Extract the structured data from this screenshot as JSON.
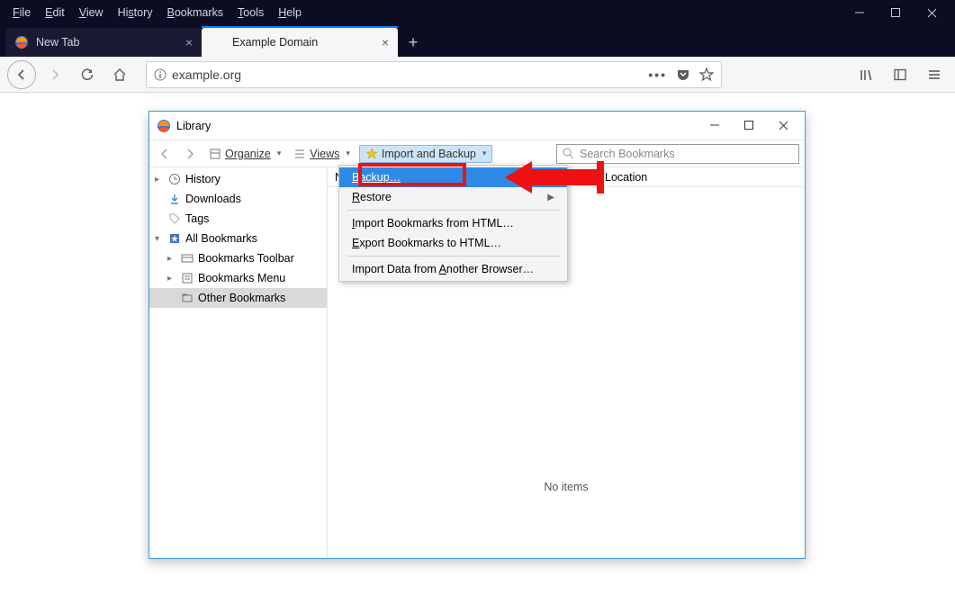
{
  "menubar": {
    "items": [
      "File",
      "Edit",
      "View",
      "History",
      "Bookmarks",
      "Tools",
      "Help"
    ]
  },
  "tabs": {
    "inactive": {
      "label": "New Tab"
    },
    "active": {
      "label": "Example Domain"
    }
  },
  "url": "example.org",
  "library": {
    "title": "Library",
    "toolbar": {
      "organize": "Organize",
      "views": "Views",
      "import_backup": "Import and Backup"
    },
    "search_placeholder": "Search Bookmarks",
    "tree": {
      "history": "History",
      "downloads": "Downloads",
      "tags": "Tags",
      "all": "All Bookmarks",
      "toolbar": "Bookmarks Toolbar",
      "menu": "Bookmarks Menu",
      "other": "Other Bookmarks"
    },
    "cols": {
      "name": "Name",
      "location": "Location"
    },
    "empty": "No items"
  },
  "dd": {
    "backup": "Backup…",
    "restore": "Restore",
    "import_html": "Import Bookmarks from HTML…",
    "export_html": "Export Bookmarks to HTML…",
    "import_browser": "Import Data from Another Browser…"
  }
}
